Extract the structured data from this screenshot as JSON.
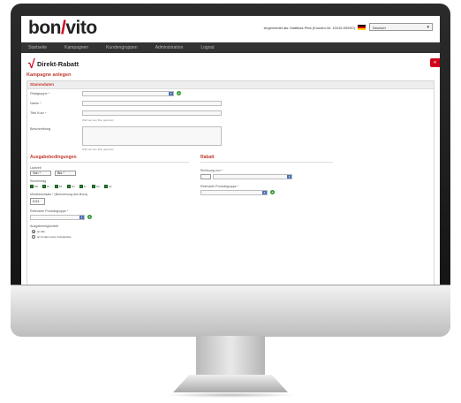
{
  "header": {
    "logo": {
      "left": "bon",
      "slash": "/",
      "right": "vito"
    },
    "user_info": "Angemeldet als: Matthias Pirla (Kunden-Nr. 10416 DEMO)",
    "language": "Deutsch"
  },
  "nav": {
    "items": [
      "Startseite",
      "Kampagnen",
      "Kundengruppen",
      "Administration",
      "Logout"
    ]
  },
  "page": {
    "title": "Direkt-Rabatt",
    "subtitle": "Kampagne anlegen",
    "back_label": "«",
    "checkmark": "√"
  },
  "stammdaten": {
    "section_title": "Stammdaten",
    "filialgruppe_label": "Filialgruppe",
    "name_label": "Name",
    "titel_label": "Titel Kurz",
    "titel_hint": "Wird auf den Bon gedruckt",
    "beschreibung_label": "Beschreibung",
    "beschreibung_hint": "Wird auf den Bon gedruckt",
    "required_mark": "*"
  },
  "ausgabe": {
    "section_title": "Ausgabebedingungen",
    "laufzeit_label": "Laufzeit",
    "von_value": "Von *",
    "bis_value": "Bis *",
    "wochentag_label": "Wochentag",
    "days": [
      "Mo",
      "Di",
      "Mi",
      "Do",
      "Fr",
      "Sa",
      "So"
    ],
    "mindestumsatz_label": "Mindestumsatz * (Berechnung des Bons)",
    "mindestumsatz_value": "0.01",
    "produktgruppe_label": "Relevante Produktgruppe",
    "moeglichkeit_label": "Ausgabemöglichkeit",
    "radio_options": [
      "an Alle",
      "an Kunden einer Kundenliste"
    ]
  },
  "rabatt": {
    "section_title": "Rabatt",
    "einloesung_label": "Einlösung von",
    "produktgruppe_label": "Relevante Produktgruppe"
  }
}
